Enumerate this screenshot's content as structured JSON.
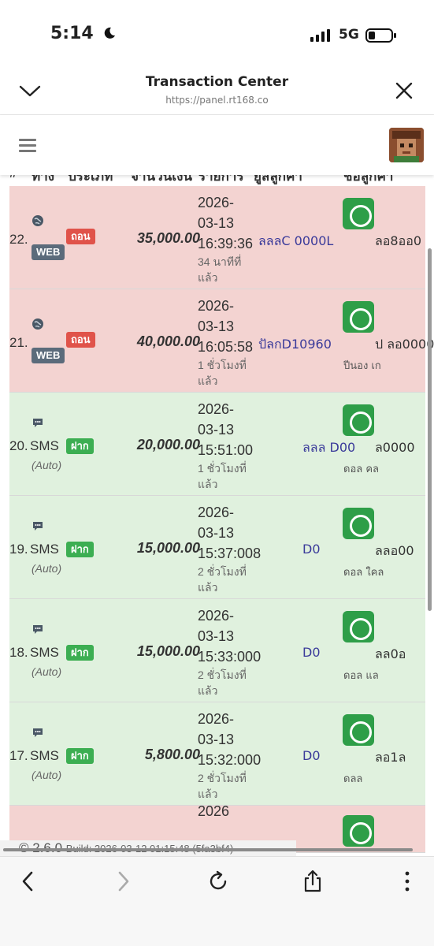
{
  "status_bar": {
    "time": "5:14",
    "network": "5G"
  },
  "browser": {
    "title": "Transaction Center",
    "url": "https://panel.rt168.co"
  },
  "table": {
    "headers": [
      "#",
      "ทาง",
      "ประเภท",
      "จำนวนเงิน",
      "รายการ",
      "ยูสลูกค้า",
      "ชื่อลูกค้า"
    ],
    "rows": [
      {
        "index": "22.",
        "channel": "WEB",
        "type": "ถอน",
        "kind": "withdraw",
        "amount": "35,000.00",
        "date": "2026-",
        "date2": "03-13",
        "time": "16:39:36",
        "ago": "34 นาทีที่",
        "ago2": "แล้ว",
        "user": "ลลลC 0000L",
        "customer": "ลอ8ออ0",
        "customer2": ""
      },
      {
        "index": "21.",
        "channel": "WEB",
        "type": "ถอน",
        "kind": "withdraw",
        "amount": "40,000.00",
        "date": "2026-",
        "date2": "03-13",
        "time": "16:05:58",
        "ago": "1 ชั่วโมงที่",
        "ago2": "แล้ว",
        "user": "ปัลกD10960",
        "customer": "ป ลอ0000",
        "customer2": "ปีนอง     เก"
      },
      {
        "index": "20.",
        "channel": "SMS",
        "type": "ฝาก",
        "kind": "deposit",
        "auto": "(Auto)",
        "amount": "20,000.00",
        "date": "2026-",
        "date2": "03-13",
        "time": "15:51:00",
        "ago": "1 ชั่วโมงที่",
        "ago2": "แล้ว",
        "user": "ลลล   D00",
        "customer": "ล0000",
        "customer2": "ดอล     คล"
      },
      {
        "index": "19.",
        "channel": "SMS",
        "type": "ฝาก",
        "kind": "deposit",
        "auto": "(Auto)",
        "amount": "15,000.00",
        "date": "2026-",
        "date2": "03-13",
        "time": "15:37:008",
        "ago": "2 ชั่วโมงที่",
        "ago2": "แล้ว",
        "user": "D0",
        "customer": "ลลอ00",
        "customer2": "ดอล     ใคล"
      },
      {
        "index": "18.",
        "channel": "SMS",
        "type": "ฝาก",
        "kind": "deposit",
        "auto": "(Auto)",
        "amount": "15,000.00",
        "date": "2026-",
        "date2": "03-13",
        "time": "15:33:000",
        "ago": "2 ชั่วโมงที่",
        "ago2": "แล้ว",
        "user": "D0",
        "customer": "ลล0อ",
        "customer2": "ดอล     แล"
      },
      {
        "index": "17.",
        "channel": "SMS",
        "type": "ฝาก",
        "kind": "deposit",
        "auto": "(Auto)",
        "amount": "5,800.00",
        "date": "2026-",
        "date2": "03-13",
        "time": "15:32:000",
        "ago": "2 ชั่วโมงที่",
        "ago2": "แล้ว",
        "user": "D0",
        "customer": "ลอ1ล",
        "customer2": "ดลล"
      }
    ],
    "partial_row_date": "2026"
  },
  "footer": {
    "version": "© 2.6.0",
    "build": "Build: 2026-03-12 01:15:48 (5fa3bf4)"
  },
  "colors": {
    "withdraw_row": "#f3d3d1",
    "deposit_row": "#e0f1de",
    "badge_withdraw": "#e0534a",
    "badge_deposit": "#3cae52",
    "badge_web": "#5b6b7b",
    "line_green": "#2e9e48"
  },
  "icons": {
    "status": [
      "moon-icon",
      "signal-icon",
      "battery-icon"
    ],
    "header": [
      "chevron-down-icon",
      "close-icon"
    ],
    "app_bar": [
      "hamburger-icon"
    ],
    "toolbar": [
      "back-icon",
      "forward-icon",
      "reload-icon",
      "share-icon",
      "more-icon"
    ]
  }
}
